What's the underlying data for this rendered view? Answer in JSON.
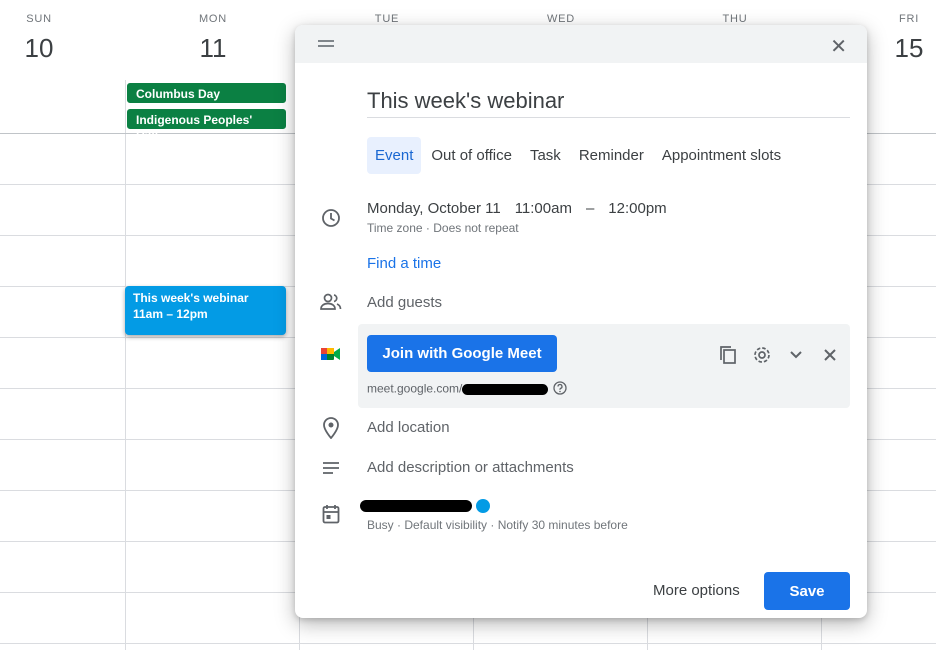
{
  "calendar": {
    "days": [
      {
        "name": "SUN",
        "num": "10"
      },
      {
        "name": "MON",
        "num": "11"
      },
      {
        "name": "TUE",
        "num": ""
      },
      {
        "name": "WED",
        "num": ""
      },
      {
        "name": "THU",
        "num": ""
      },
      {
        "name": "FRI",
        "num": "15"
      }
    ],
    "allday_events": [
      "Columbus Day",
      "Indigenous Peoples' Day"
    ],
    "event": {
      "title": "This week's webinar",
      "time": "11am – 12pm"
    }
  },
  "dialog": {
    "title_value": "This week's webinar",
    "tabs": [
      "Event",
      "Out of office",
      "Task",
      "Reminder",
      "Appointment slots"
    ],
    "date": "Monday, October 11",
    "start": "11:00am",
    "dash": "–",
    "end": "12:00pm",
    "date_sub": "Time zone · Does not repeat",
    "find_time": "Find a time",
    "add_guests": "Add guests",
    "meet_button": "Join with Google Meet",
    "meet_link": "meet.google.com/",
    "add_location": "Add location",
    "add_description": "Add description or attachments",
    "owner_sub": "Busy · Default visibility · Notify 30 minutes before",
    "more_options": "More options",
    "save": "Save"
  },
  "colors": {
    "accent": "#1a73e8",
    "holiday": "#0b8043",
    "event": "#039be5"
  }
}
